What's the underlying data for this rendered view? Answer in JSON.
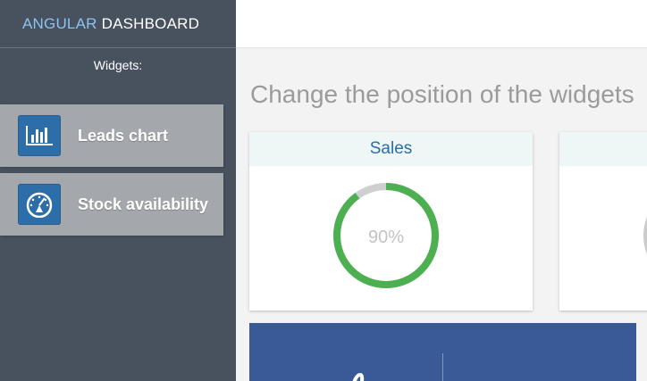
{
  "brand": {
    "accent": "ANGULAR",
    "rest": "DASHBOARD"
  },
  "sidebar": {
    "heading": "Widgets:",
    "items": [
      {
        "label": "Leads chart",
        "icon": "bar-chart-icon"
      },
      {
        "label": "Stock availability",
        "icon": "gauge-icon"
      }
    ]
  },
  "main": {
    "title": "Change the position of the widgets",
    "cards": [
      {
        "header": "Sales",
        "percent_label": "90%",
        "percent": 90,
        "color": "#4caf50"
      },
      {
        "header": "",
        "percent_label": "",
        "percent": null,
        "color": "#cccccc"
      }
    ]
  },
  "colors": {
    "sidebar": "#48525e",
    "accent": "#2a6ea7",
    "bottom_card": "#3a5a97",
    "donut": "#4caf50"
  }
}
